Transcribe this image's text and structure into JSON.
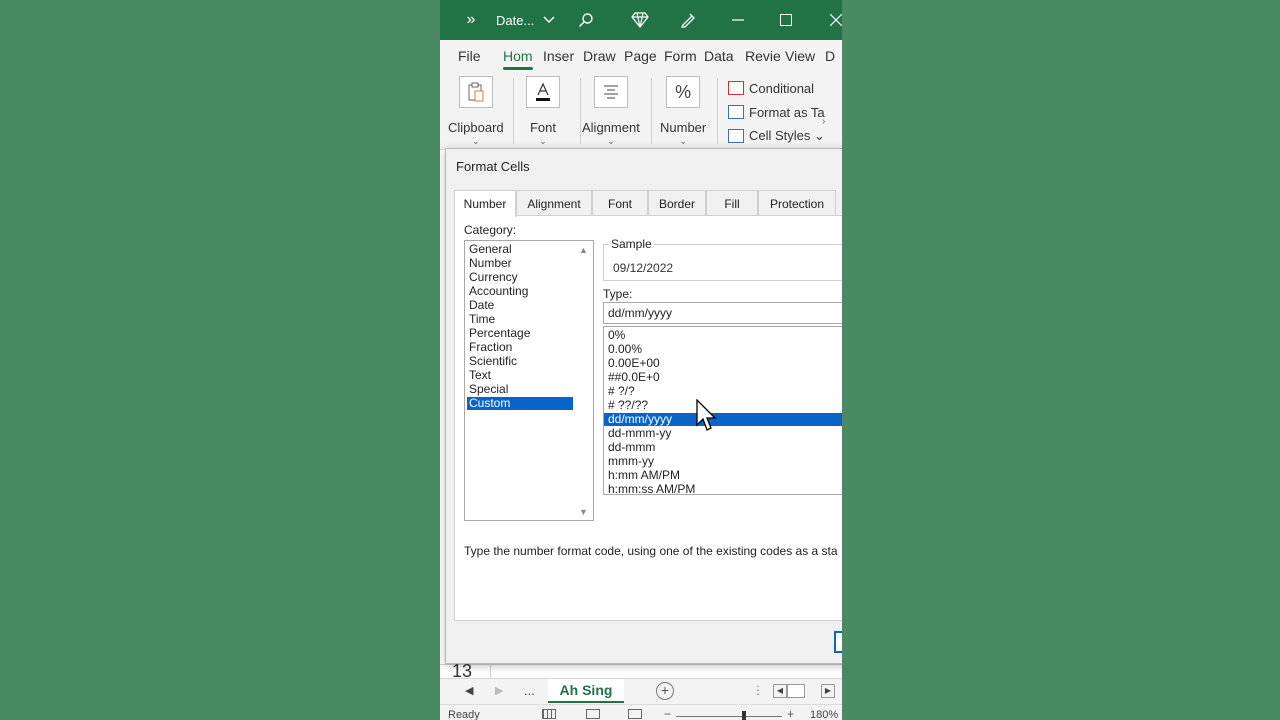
{
  "titlebar": {
    "more": "»",
    "title": "Date...",
    "chevron": "⌄"
  },
  "ribbon_tabs": [
    "File",
    "Hom",
    "Inser",
    "Draw",
    "Page",
    "Form",
    "Data",
    "Revie",
    "View",
    "D"
  ],
  "ribbon_groups": {
    "clipboard": "Clipboard",
    "font": "Font",
    "alignment": "Alignment",
    "number": "Number"
  },
  "styles": {
    "conditional": "Conditional",
    "format_as_table": "Format as Ta",
    "cell_styles": "Cell Styles ⌄"
  },
  "dialog": {
    "title": "Format Cells",
    "tabs": [
      "Number",
      "Alignment",
      "Font",
      "Border",
      "Fill",
      "Protection"
    ],
    "category_label": "Category:",
    "categories": [
      "General",
      "Number",
      "Currency",
      "Accounting",
      "Date",
      "Time",
      "Percentage",
      "Fraction",
      "Scientific",
      "Text",
      "Special",
      "Custom"
    ],
    "selected_category": "Custom",
    "sample_label": "Sample",
    "sample_value": "09/12/2022",
    "type_label": "Type:",
    "type_value": "dd/mm/yyyy",
    "types": [
      "0%",
      "0.00%",
      "0.00E+00",
      "##0.0E+0",
      "# ?/?",
      "# ??/??",
      "dd/mm/yyyy",
      "dd-mmm-yy",
      "dd-mmm",
      "mmm-yy",
      "h:mm AM/PM",
      "h:mm:ss AM/PM"
    ],
    "selected_type": "dd/mm/yyyy",
    "hint": "Type the number format code, using one of the existing codes as a sta"
  },
  "sheet": {
    "row_number": "13",
    "dots": "...",
    "active_tab": "Ah Sing"
  },
  "status": {
    "ready": "Ready",
    "zoom": "180%"
  },
  "colors": {
    "excel_green": "#217346",
    "selection_blue": "#0a64c8",
    "background": "#4a8a62"
  }
}
